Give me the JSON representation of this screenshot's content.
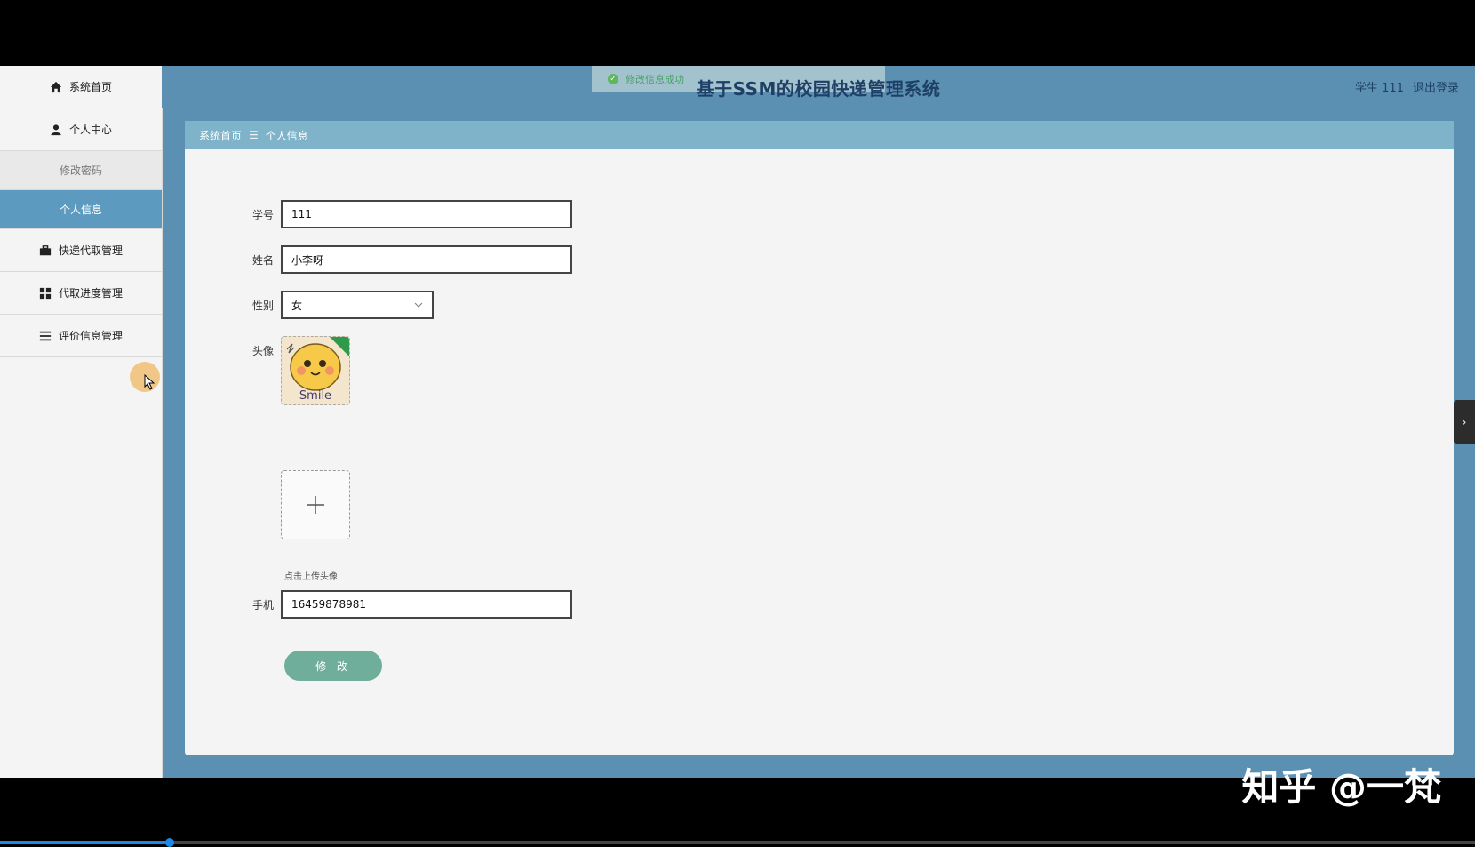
{
  "header": {
    "toast": "修改信息成功",
    "title": "基于SSM的校园快递管理系统",
    "user": "学生 111",
    "logout": "退出登录"
  },
  "sidebar": {
    "items": [
      {
        "label": "系统首页",
        "icon": "home-icon"
      },
      {
        "label": "个人中心",
        "icon": "user-icon"
      },
      {
        "label": "修改密码"
      },
      {
        "label": "个人信息"
      },
      {
        "label": "快递代取管理",
        "icon": "briefcase-icon"
      },
      {
        "label": "代取进度管理",
        "icon": "grid-icon"
      },
      {
        "label": "评价信息管理",
        "icon": "list-icon"
      }
    ]
  },
  "breadcrumb": {
    "home": "系统首页",
    "separator": "☰",
    "current": "个人信息"
  },
  "form": {
    "student_id": {
      "label": "学号",
      "value": "111"
    },
    "name": {
      "label": "姓名",
      "value": "小李呀"
    },
    "gender": {
      "label": "性别",
      "value": "女"
    },
    "avatar": {
      "label": "头像",
      "image_text": "Smile",
      "upload_tip": "点击上传头像"
    },
    "phone": {
      "label": "手机",
      "value": "16459878981"
    },
    "submit": "修 改"
  },
  "watermark": "知乎 @一梵",
  "colors": {
    "header": "#5b90b3",
    "active": "#5c9bbf",
    "breadcrumb": "#7eb3c9",
    "button": "#6fae9a"
  }
}
